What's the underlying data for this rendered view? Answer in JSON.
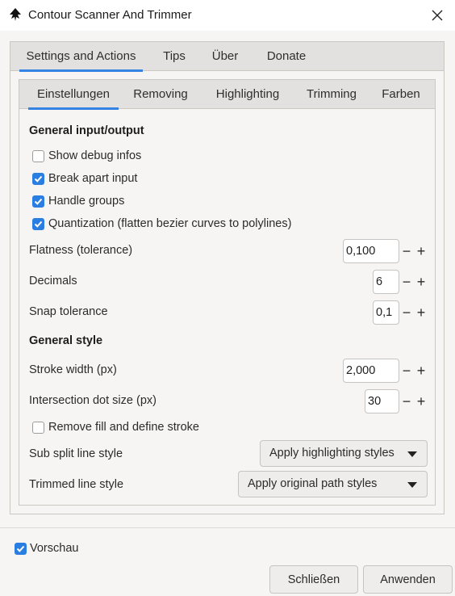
{
  "window": {
    "title": "Contour Scanner And Trimmer"
  },
  "outer_tabs": [
    "Settings and Actions",
    "Tips",
    "Über",
    "Donate"
  ],
  "inner_tabs": [
    "Einstellungen",
    "Removing",
    "Highlighting",
    "Trimming",
    "Farben"
  ],
  "general_io": {
    "title": "General input/output",
    "show_debug": {
      "label": "Show debug infos",
      "checked": false
    },
    "break_apart": {
      "label": "Break apart input",
      "checked": true
    },
    "handle_groups": {
      "label": "Handle groups",
      "checked": true
    },
    "quantization": {
      "label": "Quantization (flatten bezier curves to polylines)",
      "checked": true
    },
    "flatness": {
      "label": "Flatness (tolerance)",
      "value": "0,100"
    },
    "decimals": {
      "label": "Decimals",
      "value": "6"
    },
    "snap": {
      "label": "Snap tolerance",
      "value": "0,1"
    }
  },
  "general_style": {
    "title": "General style",
    "stroke_width": {
      "label": "Stroke width (px)",
      "value": "2,000"
    },
    "dot_size": {
      "label": "Intersection dot size (px)",
      "value": "30"
    },
    "remove_fill": {
      "label": "Remove fill and define stroke",
      "checked": false
    },
    "sub_split": {
      "label": "Sub split line style",
      "value": "Apply highlighting styles"
    },
    "trimmed": {
      "label": "Trimmed line style",
      "value": "Apply original path styles"
    }
  },
  "spin_symbols": {
    "minus": "−",
    "plus": "+"
  },
  "preview": {
    "label": "Vorschau",
    "checked": true
  },
  "buttons": {
    "close": "Schließen",
    "apply": "Anwenden"
  },
  "colors": {
    "accent": "#3584e4",
    "checkbox": "#2a7de1"
  }
}
